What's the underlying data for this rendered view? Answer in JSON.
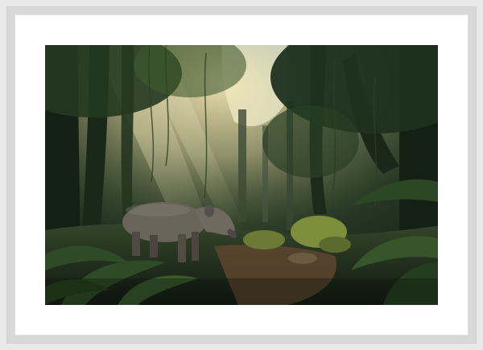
{
  "artwork": {
    "subject": "tapir-in-rainforest",
    "colors": {
      "sky": "#a9cdea",
      "canopy_dark": "#1c2b1b",
      "canopy_mid": "#3c5b2d",
      "sunlight": "#f2e2a6",
      "tapir": "#6a645b",
      "trail": "#7a5a3c",
      "moss": "#7f8e3a"
    }
  }
}
